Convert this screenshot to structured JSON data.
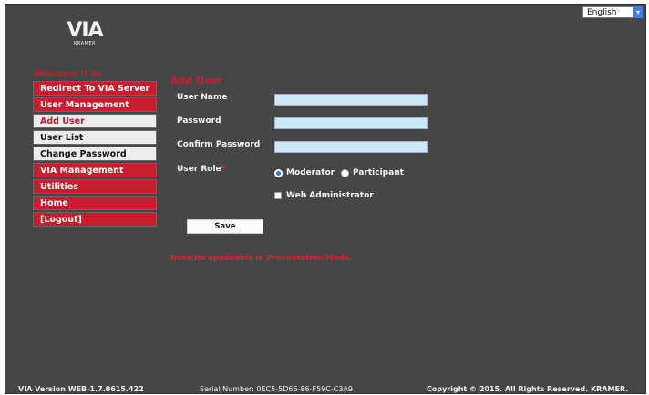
{
  "language": {
    "selected": "English"
  },
  "logo": {
    "main": "VIA",
    "sub": "KRAMER"
  },
  "welcome": "Welcome !! aa",
  "menu": [
    {
      "label": "Redirect To VIA Server",
      "style": "red"
    },
    {
      "label": "User Management",
      "style": "red"
    },
    {
      "label": "Add User",
      "style": "grey",
      "active": true
    },
    {
      "label": "User List",
      "style": "grey"
    },
    {
      "label": "Change Password",
      "style": "grey"
    },
    {
      "label": "VIA Management",
      "style": "red"
    },
    {
      "label": "Utilities",
      "style": "red"
    },
    {
      "label": "Home",
      "style": "red"
    },
    {
      "label": "[Logout]",
      "style": "red"
    }
  ],
  "form": {
    "title": "Add User",
    "username_label": "User Name",
    "username_value": "",
    "password_label": "Password",
    "password_value": "",
    "confirm_label": "Confirm Password",
    "confirm_value": "",
    "role_label": "User Role",
    "required_mark": "*",
    "role_moderator": "Moderator",
    "role_participant": "Participant",
    "role_selected": "Moderator",
    "web_admin_label": "Web Administrator",
    "web_admin_checked": false,
    "save_label": "Save",
    "note": "Note:Its applicable in Presentation Mode."
  },
  "footer": {
    "version": "VIA Version WEB-1.7.0615.422",
    "serial": "Serial Number: 0EC5-5D66-86-F59C-C3A9",
    "copyright": "Copyright © 2015. All Rights Reserved. KRAMER."
  },
  "colors": {
    "background": "#464646",
    "accent_red": "#c91d2e",
    "field_fill": "#cbe8f5",
    "radio_selected": "#2f7be8"
  }
}
